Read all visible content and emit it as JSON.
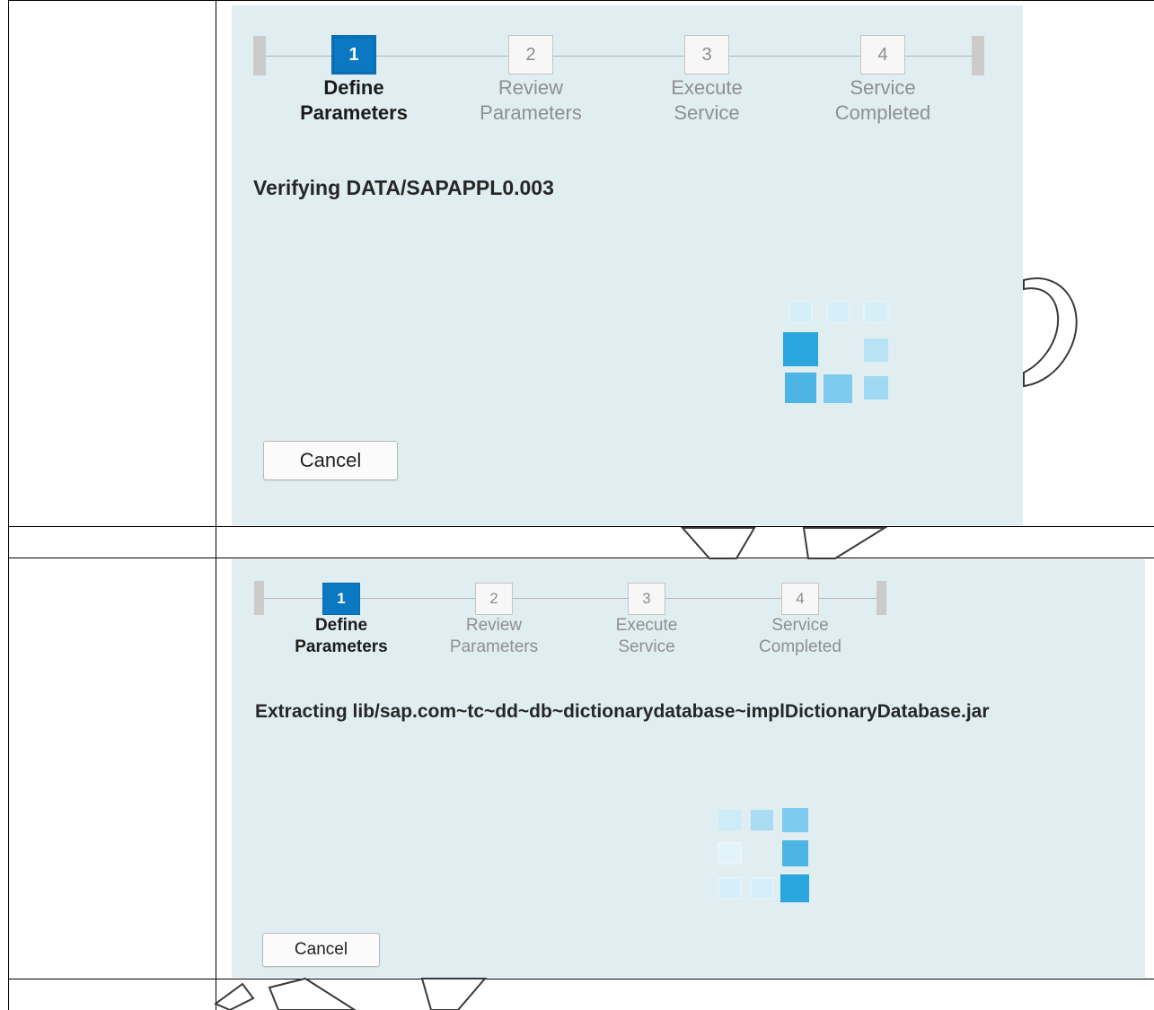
{
  "panel_top": {
    "steps": [
      {
        "number": "1",
        "line1": "Define",
        "line2": "Parameters",
        "active": true
      },
      {
        "number": "2",
        "line1": "Review",
        "line2": "Parameters",
        "active": false
      },
      {
        "number": "3",
        "line1": "Execute",
        "line2": "Service",
        "active": false
      },
      {
        "number": "4",
        "line1": "Service",
        "line2": "Completed",
        "active": false
      }
    ],
    "status_text": "Verifying DATA/SAPAPPL0.003",
    "cancel_label": "Cancel"
  },
  "panel_bottom": {
    "steps": [
      {
        "number": "1",
        "line1": "Define",
        "line2": "Parameters",
        "active": true
      },
      {
        "number": "2",
        "line1": "Review",
        "line2": "Parameters",
        "active": false
      },
      {
        "number": "3",
        "line1": "Execute",
        "line2": "Service",
        "active": false
      },
      {
        "number": "4",
        "line1": "Service",
        "line2": "Completed",
        "active": false
      }
    ],
    "status_text": "Extracting lib/sap.com~tc~dd~db~dictionarydatabase~implDictionaryDatabase.jar",
    "cancel_label": "Cancel"
  },
  "colors": {
    "panel_bg": "#e0eef2",
    "active_step": "#0a78c2",
    "spinner_blue": "#2aa5de"
  }
}
